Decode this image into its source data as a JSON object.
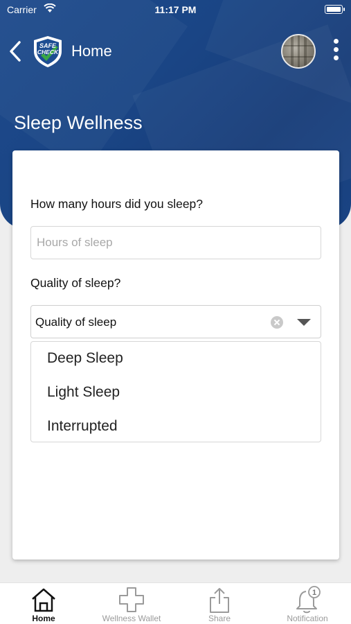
{
  "status_bar": {
    "carrier": "Carrier",
    "time": "11:17 PM"
  },
  "header": {
    "title": "Home",
    "logo_text_line1": "SAFE",
    "logo_text_line2": "CHECK",
    "page_title": "Sleep Wellness"
  },
  "form": {
    "hours_question": "How many hours did you sleep?",
    "hours_placeholder": "Hours of sleep",
    "hours_value": "",
    "quality_question": "Quality of sleep?",
    "quality_selected": "Quality of sleep",
    "quality_options": [
      "Deep Sleep",
      "Light Sleep",
      "Interrupted"
    ]
  },
  "tabbar": {
    "tabs": [
      {
        "label": "Home",
        "icon": "home-icon",
        "active": true
      },
      {
        "label": "Wellness Wallet",
        "icon": "medical-cross-icon",
        "active": false
      },
      {
        "label": "Share",
        "icon": "share-icon",
        "active": false
      },
      {
        "label": "Notification",
        "icon": "bell-icon",
        "active": false,
        "badge": "1"
      }
    ]
  },
  "colors": {
    "header_blue": "#1b4585",
    "logo_green": "#3aa845"
  }
}
